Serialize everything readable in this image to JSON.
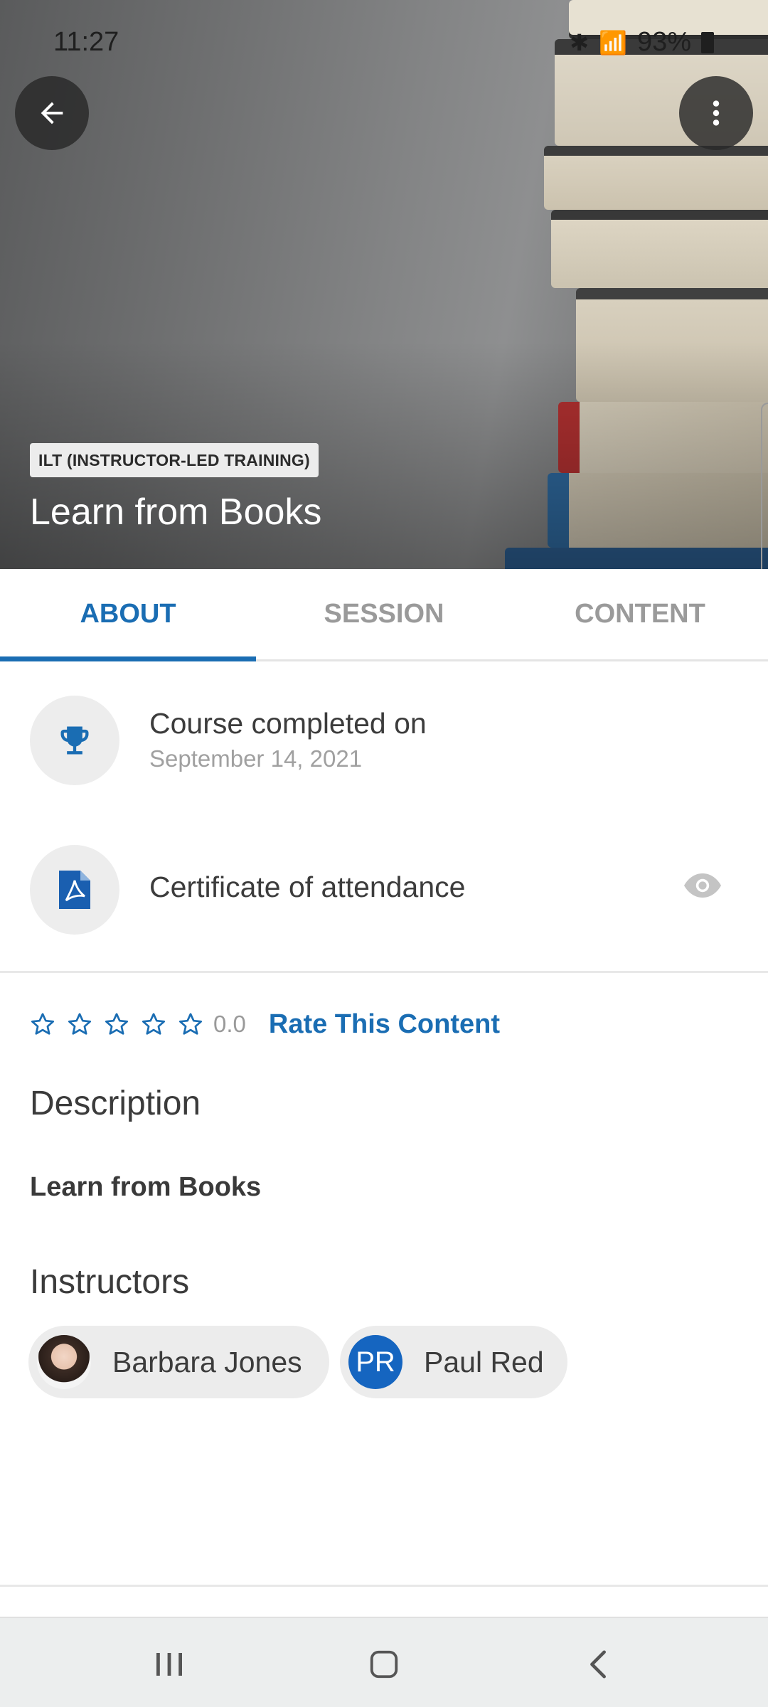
{
  "status_bar": {
    "time": "11:27",
    "battery": "93%"
  },
  "course": {
    "type_badge": "ILT (INSTRUCTOR-LED TRAINING)",
    "title": "Learn from Books"
  },
  "tabs": [
    {
      "label": "ABOUT",
      "active": true
    },
    {
      "label": "SESSION",
      "active": false
    },
    {
      "label": "CONTENT",
      "active": false
    }
  ],
  "completion": {
    "label": "Course completed on",
    "date": "September 14, 2021"
  },
  "certificate": {
    "label": "Certificate of attendance"
  },
  "rating": {
    "value": "0.0",
    "stars_filled": 0,
    "stars_total": 5,
    "rate_label": "Rate This Content"
  },
  "description": {
    "heading": "Description",
    "text": "Learn from Books"
  },
  "instructors": {
    "heading": "Instructors",
    "list": [
      {
        "name": "Barbara Jones",
        "initials": ""
      },
      {
        "name": "Paul Red",
        "initials": "PR"
      }
    ]
  },
  "colors": {
    "accent": "#1a6db3",
    "avatar_pr": "#1565c0"
  }
}
